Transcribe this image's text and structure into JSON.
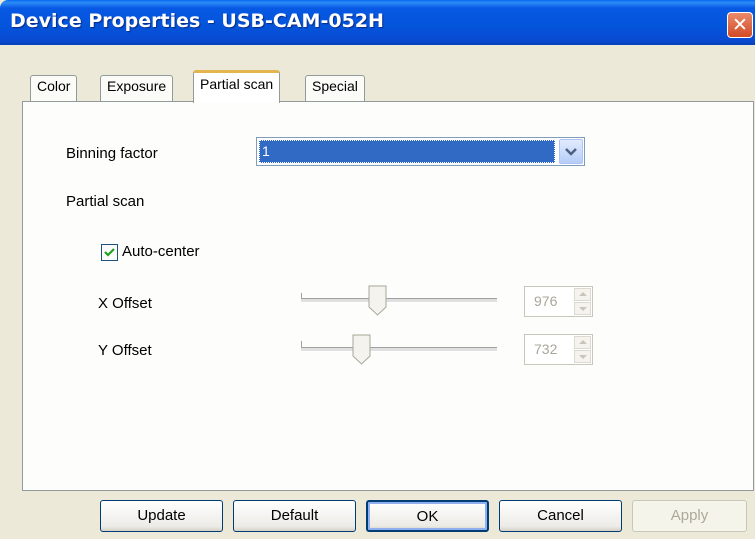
{
  "window": {
    "title": "Device Properties - USB-CAM-052H",
    "close_label": "✕"
  },
  "tabs": [
    {
      "label": "Color"
    },
    {
      "label": "Exposure"
    },
    {
      "label": "Partial scan"
    },
    {
      "label": "Special"
    }
  ],
  "active_tab": "Partial scan",
  "binning": {
    "label": "Binning factor",
    "value": "1"
  },
  "partial_scan": {
    "heading": "Partial scan",
    "auto_center": {
      "label": "Auto-center",
      "checked": true
    },
    "x_offset": {
      "label": "X Offset",
      "value": "976",
      "slider_fraction": 0.39
    },
    "y_offset": {
      "label": "Y Offset",
      "value": "732",
      "slider_fraction": 0.32
    }
  },
  "buttons": {
    "update": "Update",
    "default": "Default",
    "ok": "OK",
    "cancel": "Cancel",
    "apply": "Apply"
  },
  "colors": {
    "titlebar": "#0454db",
    "selection": "#316ac5",
    "tab_highlight": "#e4b54e"
  }
}
